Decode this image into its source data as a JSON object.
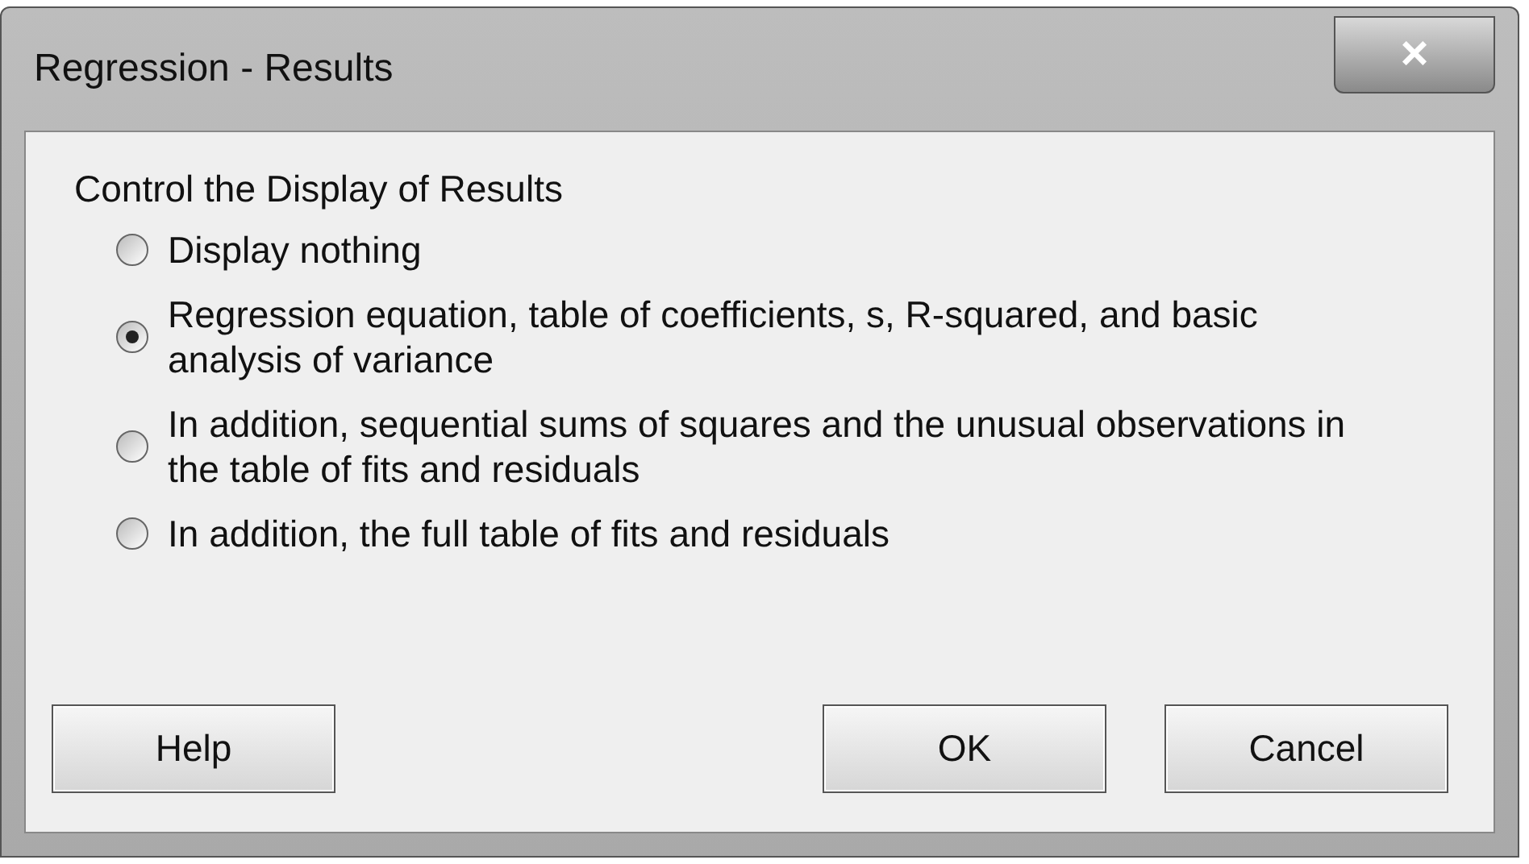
{
  "window": {
    "title": "Regression - Results",
    "close": "×"
  },
  "group": {
    "label": "Control the Display of Results",
    "options": [
      {
        "label": "Display nothing",
        "selected": false
      },
      {
        "label": "Regression equation, table of coefficients, s, R-squared, and basic analysis of variance",
        "selected": true
      },
      {
        "label": "In addition, sequential sums of squares and the unusual observations in the table of fits and residuals",
        "selected": false
      },
      {
        "label": "In addition, the full table of fits and residuals",
        "selected": false
      }
    ]
  },
  "buttons": [
    {
      "label": "Help",
      "kind": "left"
    },
    {
      "label": "OK",
      "kind": "right"
    },
    {
      "label": "Cancel",
      "kind": "right"
    }
  ]
}
